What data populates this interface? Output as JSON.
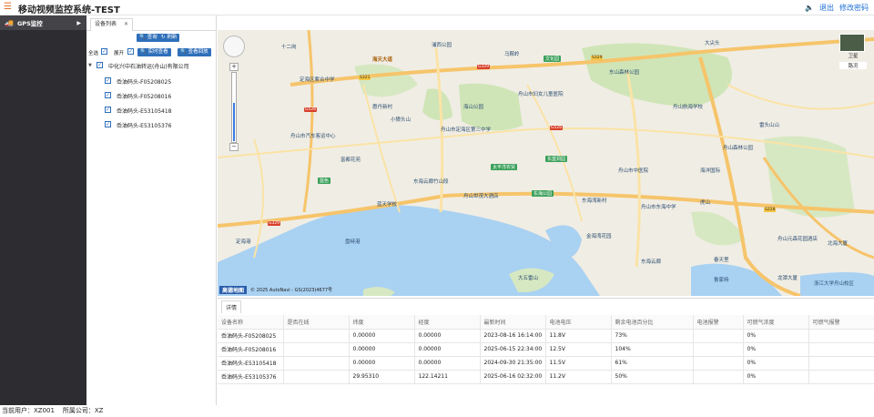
{
  "header": {
    "title": "移动视频监控系统-TEST",
    "logout": "退出",
    "change_password": "修改密码"
  },
  "sidebar": {
    "gps_item": "GPS监控"
  },
  "left_panel": {
    "tab_label": "设备列表",
    "buttons": {
      "query": "查询",
      "refresh": "刷新",
      "realtime_view": "实时查看",
      "playback_view": "查看回放"
    },
    "labels": {
      "select_all": "全选",
      "expand": "展开"
    },
    "tree": {
      "company": "中化兴中石油转运(舟山)有限公司",
      "devices": [
        "岙油码头-F05208025",
        "岙油码头-F05208016",
        "岙油码头-E53105418",
        "岙油码头-E53105376"
      ]
    }
  },
  "map": {
    "satellite": "卫星",
    "traffic": "路况",
    "copyright": "© 2025 AutoNavi - GS(2023)4677号",
    "logo": "高德地图",
    "labels": [
      {
        "t": "十二岗"
      },
      {
        "t": "海天大道"
      },
      {
        "t": "定海区紫合中学"
      },
      {
        "t": "惠丹新村"
      },
      {
        "t": "小獐头山"
      },
      {
        "t": "舟山市汽车客运中心"
      },
      {
        "t": "舟山市定海区第三中学"
      },
      {
        "t": "舟山市妇女儿童医院"
      },
      {
        "t": "海山公园"
      },
      {
        "t": "富都花苑"
      },
      {
        "t": "东海云廊竹山段"
      },
      {
        "t": "舟山世茂大酒店"
      },
      {
        "t": "蓝天学校"
      },
      {
        "t": "东海湾新村"
      },
      {
        "t": "舟山市东海中学"
      },
      {
        "t": "舟山市中医院"
      },
      {
        "t": "金海湾花园"
      },
      {
        "t": "东海云廊"
      },
      {
        "t": "大五雷山"
      },
      {
        "t": "舟山元森花园酒店"
      },
      {
        "t": "舟山航海学校"
      },
      {
        "t": "东山森林公园"
      },
      {
        "t": "舟山森林公园"
      },
      {
        "t": "雷头山山"
      },
      {
        "t": "盘峙港"
      },
      {
        "t": "浙江大学舟山校区"
      },
      {
        "t": "龙潭大厦"
      },
      {
        "t": "北海大厦"
      },
      {
        "t": "虎山"
      },
      {
        "t": "春天里"
      },
      {
        "t": "马鞍岭"
      },
      {
        "t": "浦西公园"
      },
      {
        "t": "鲁家峙"
      },
      {
        "t": "大尖头"
      },
      {
        "t": "海洋国际"
      },
      {
        "t": "定海港"
      }
    ],
    "roads": [
      "G329",
      "S321",
      "G526",
      "G329",
      "S329",
      "G526",
      "S228"
    ],
    "badges": [
      "文化园",
      "太平洋农贸",
      "东堡洞园",
      "东海公园",
      "蓝色"
    ]
  },
  "detail": {
    "tab": "详情",
    "columns": [
      "设备名称",
      "是否在线",
      "纬度",
      "经度",
      "最新时间",
      "电池电压",
      "剩余电池百分比",
      "电池报警",
      "可燃气浓度",
      "可燃气报警"
    ],
    "rows": [
      [
        "岙油码头-F05208025",
        "",
        "0.00000",
        "0.00000",
        "2023-08-16 16:14:00",
        "11.8V",
        "73%",
        "",
        "0%",
        ""
      ],
      [
        "岙油码头-F05208016",
        "",
        "0.00000",
        "0.00000",
        "2025-06-15 22:34:00",
        "12.5V",
        "104%",
        "",
        "0%",
        ""
      ],
      [
        "岙油码头-E53105418",
        "",
        "0.00000",
        "0.00000",
        "2024-09-30 21:35:00",
        "11.5V",
        "61%",
        "",
        "0%",
        ""
      ],
      [
        "岙油码头-E53105376",
        "",
        "29.95310",
        "122.14211",
        "2025-06-16 02:32:00",
        "11.2V",
        "50%",
        "",
        "0%",
        ""
      ]
    ]
  },
  "status": {
    "user_label": "当前用户：",
    "user": "XZ001",
    "company_label": "所属公司：",
    "company": "XZ"
  },
  "colors": {
    "accent": "#2f6fba",
    "brand_orange": "#e8722a",
    "sidebar": "#2d2d31",
    "sea": "#a9d1f2"
  }
}
